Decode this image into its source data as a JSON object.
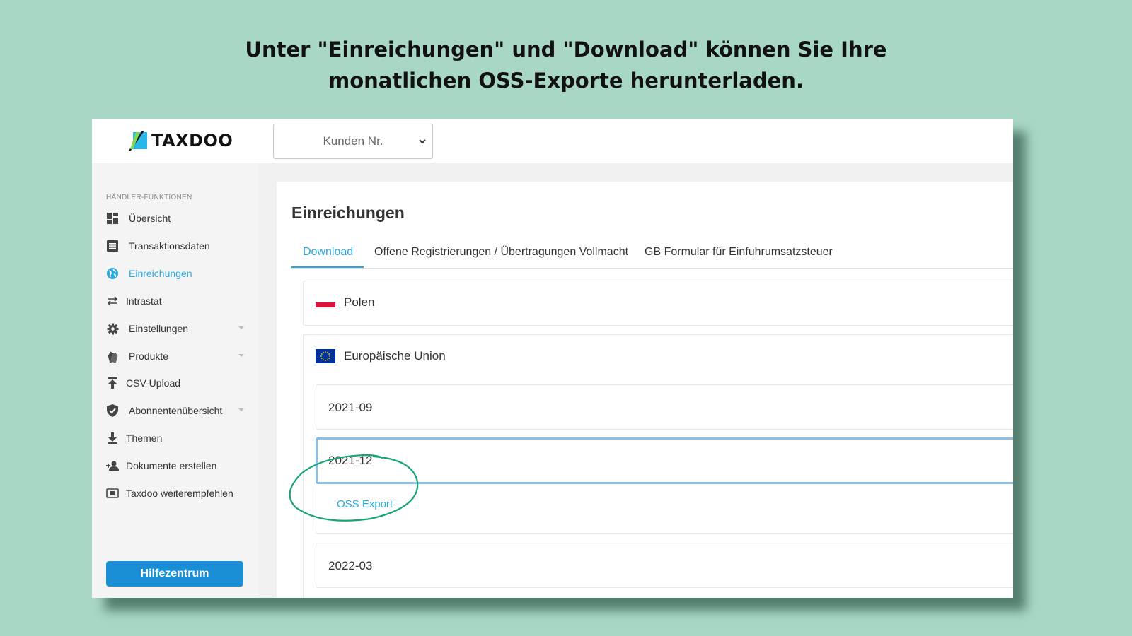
{
  "headline": {
    "line1": "Unter \"Einreichungen\" und \"Download\" können Sie Ihre",
    "line2": "monatlichen OSS-Exporte herunterladen."
  },
  "app": {
    "logo_text": "TAXDOO",
    "customer_select": {
      "value": "Kunden Nr."
    }
  },
  "sidebar": {
    "section_label": "HÄNDLER-FUNKTIONEN",
    "items": [
      {
        "label": "Übersicht",
        "icon": "dashboard-icon"
      },
      {
        "label": "Transaktionsdaten",
        "icon": "list-icon"
      },
      {
        "label": "Einreichungen",
        "icon": "globe-icon",
        "active": true
      },
      {
        "label": "Intrastat",
        "icon": "swap-arrows-icon"
      },
      {
        "label": "Einstellungen",
        "icon": "gear-icon",
        "expandable": true
      },
      {
        "label": "Produkte",
        "icon": "tags-icon",
        "expandable": true
      },
      {
        "label": "CSV-Upload",
        "icon": "upload-icon"
      },
      {
        "label": "Abonnentenübersicht",
        "icon": "shield-check-icon",
        "expandable": true
      },
      {
        "label": "Themen",
        "icon": "download-icon"
      },
      {
        "label": "Dokumente erstellen",
        "icon": "user-add-icon"
      },
      {
        "label": "Taxdoo weiterempfehlen",
        "icon": "money-icon"
      }
    ],
    "help_button": "Hilfezentrum"
  },
  "main": {
    "title": "Einreichungen",
    "tabs": [
      {
        "label": "Download",
        "active": true
      },
      {
        "label": "Offene Registrierungen / Übertragungen Vollmacht"
      },
      {
        "label": "GB Formular für Einfuhrumsatzsteuer"
      }
    ],
    "countries": [
      {
        "name": "Polen",
        "flag": "poland-flag"
      },
      {
        "name": "Europäische Union",
        "flag": "eu-flag",
        "periods": [
          {
            "label": "2021-09"
          },
          {
            "label": "2021-12",
            "expanded": true,
            "link": "OSS Export"
          },
          {
            "label": "2022-03"
          }
        ]
      }
    ]
  },
  "colors": {
    "background": "#a8d8c5",
    "accent": "#2aa8dc",
    "help_button": "#1a8fd6",
    "annotation_circle": "#17a47a"
  }
}
